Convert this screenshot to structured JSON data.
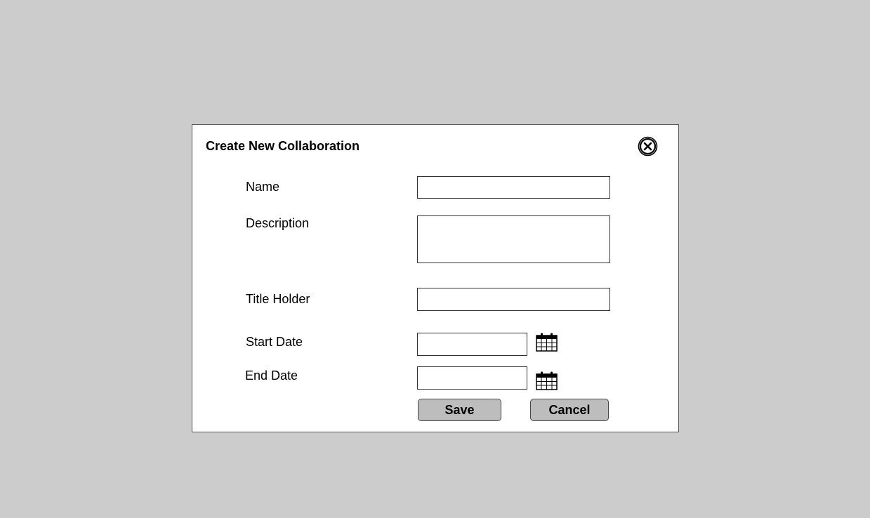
{
  "dialog": {
    "title": "Create New Collaboration",
    "close_icon": "close-circle-x-icon"
  },
  "form": {
    "name": {
      "label": "Name",
      "value": "",
      "placeholder": ""
    },
    "description": {
      "label": "Description",
      "value": "",
      "placeholder": ""
    },
    "title_holder": {
      "label": "Title Holder",
      "value": "",
      "placeholder": ""
    },
    "start_date": {
      "label": "Start Date",
      "value": "",
      "placeholder": "",
      "icon": "calendar-icon"
    },
    "end_date": {
      "label": "End Date",
      "value": "",
      "placeholder": "",
      "icon": "calendar-icon"
    }
  },
  "buttons": {
    "save_label": "Save",
    "cancel_label": "Cancel"
  },
  "colors": {
    "backdrop": "#cccccc",
    "dialog_bg": "#ffffff",
    "button_bg": "#bdbdbd"
  }
}
